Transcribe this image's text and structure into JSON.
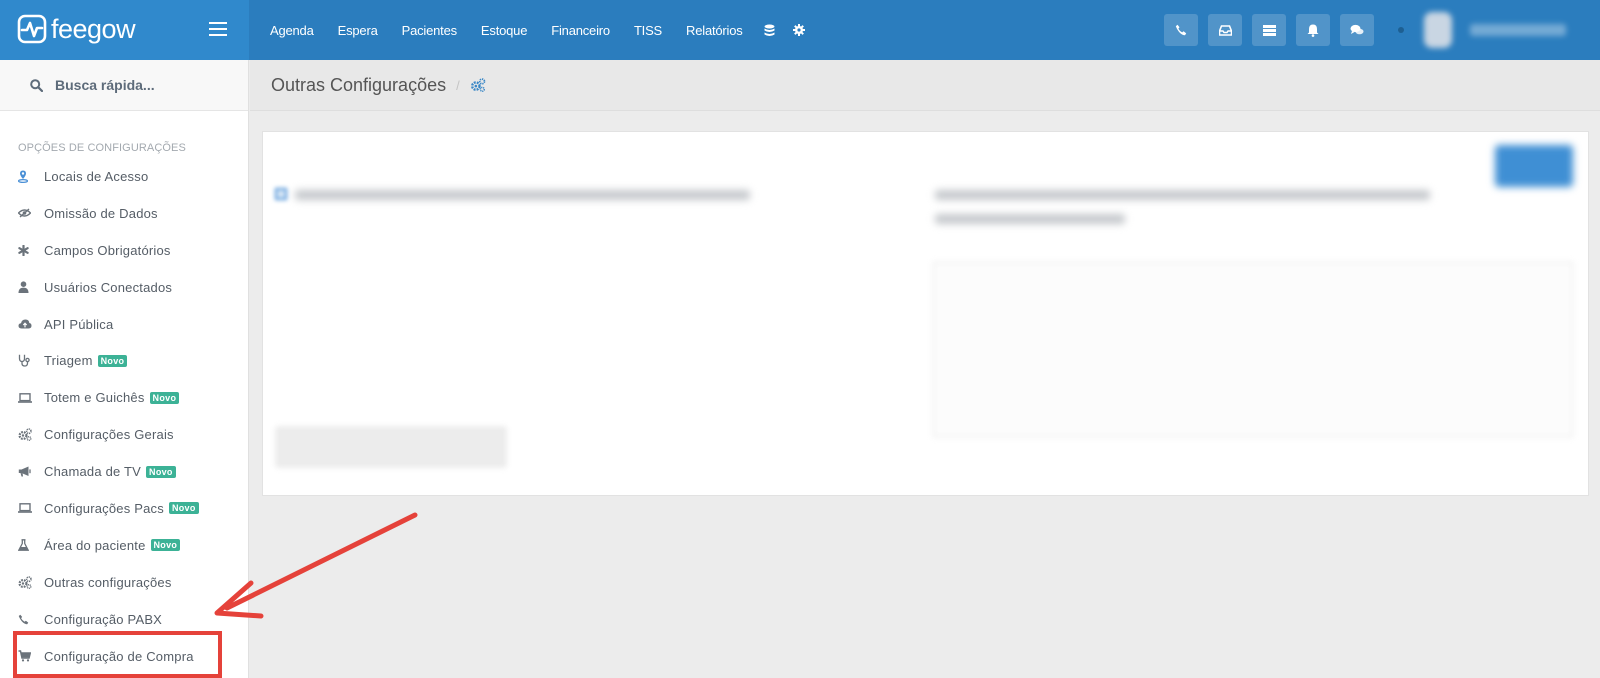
{
  "app": {
    "name": "feegow"
  },
  "colors": {
    "topbar": "#2b7dbe",
    "logo_bg": "#3089cc",
    "badge": "#3cb296",
    "highlight": "#e5423a"
  },
  "topnav": {
    "items": [
      "Agenda",
      "Espera",
      "Pacientes",
      "Estoque",
      "Financeiro",
      "TISS",
      "Relatórios"
    ],
    "icons": [
      "database-icon",
      "gear-icon"
    ]
  },
  "topright": {
    "buttons": [
      "phone-icon",
      "inbox-icon",
      "list-icon",
      "bell-icon",
      "chat-icon"
    ]
  },
  "search": {
    "placeholder": "Busca rápida..."
  },
  "sidebar": {
    "section_title": "OPÇÕES DE CONFIGURAÇÕES",
    "items": [
      {
        "label": "Locais de Acesso",
        "icon": "map-marker-icon",
        "badge": ""
      },
      {
        "label": "Omissão de Dados",
        "icon": "eye-slash-icon",
        "badge": ""
      },
      {
        "label": "Campos Obrigatórios",
        "icon": "asterisk-icon",
        "badge": ""
      },
      {
        "label": "Usuários Conectados",
        "icon": "user-icon",
        "badge": ""
      },
      {
        "label": "API Pública",
        "icon": "cloud-icon",
        "badge": ""
      },
      {
        "label": "Triagem",
        "icon": "stethoscope-icon",
        "badge": "Novo"
      },
      {
        "label": "Totem e Guichês",
        "icon": "laptop-icon",
        "badge": "Novo"
      },
      {
        "label": "Configurações Gerais",
        "icon": "cogs-icon",
        "badge": ""
      },
      {
        "label": "Chamada de TV",
        "icon": "bullhorn-icon",
        "badge": "Novo"
      },
      {
        "label": "Configurações Pacs",
        "icon": "laptop-icon",
        "badge": "Novo"
      },
      {
        "label": "Área do paciente",
        "icon": "flask-icon",
        "badge": "Novo"
      },
      {
        "label": "Outras configurações",
        "icon": "cogs-icon",
        "badge": ""
      },
      {
        "label": "Configuração PABX",
        "icon": "phone-icon",
        "badge": ""
      },
      {
        "label": "Configuração de Compra",
        "icon": "cart-icon",
        "badge": ""
      }
    ]
  },
  "breadcrumb": {
    "title": "Outras Configurações",
    "separator": "/",
    "icon": "cogs-icon"
  }
}
